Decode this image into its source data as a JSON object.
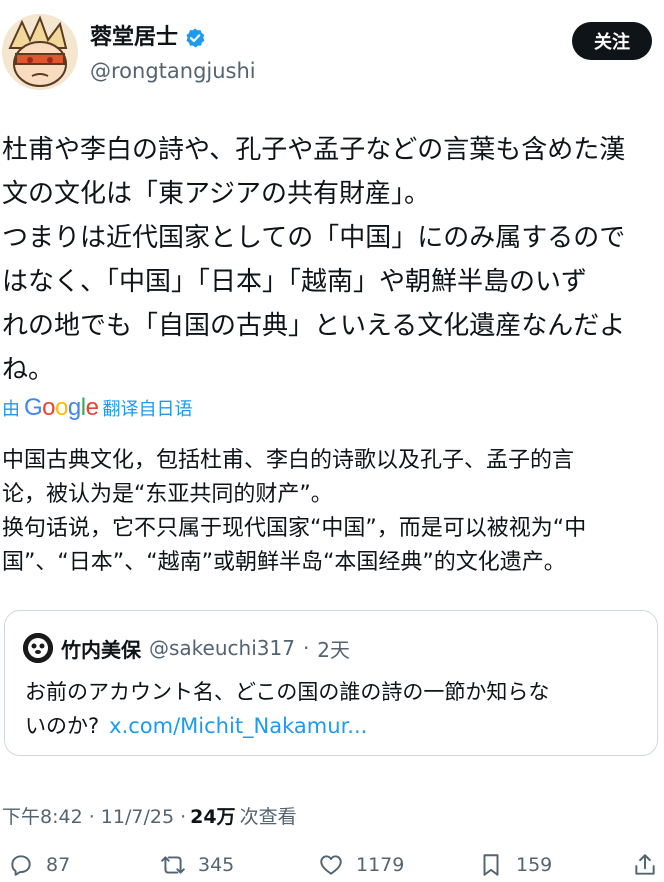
{
  "author": {
    "display_name": "蓉堂居士",
    "handle": "@rongtangjushi",
    "follow_label": "关注"
  },
  "tweet": {
    "text": "杜甫や李白の詩や、孔子や孟子などの言葉も含めた漢\n文の文化は「東アジアの共有財産」。\nつまりは近代国家としての「中国」にのみ属するので\nはなく、「中国」「日本」「越南」や朝鮮半島のいず\nれの地でも「自国の古典」といえる文化遺産なんだよ\nね。"
  },
  "translation": {
    "prefix": "由",
    "provider": "Google",
    "action": "翻译自日语",
    "text": "中国古典文化，包括杜甫、李白的诗歌以及孔子、孟子的言\n论，被认为是“东亚共同的财产”。\n换句话说，它不只属于现代国家“中国”，而是可以被视为“中\n国”、“日本”、“越南”或朝鲜半岛“本国经典”的文化遗产。"
  },
  "quote": {
    "display_name": "竹内美保",
    "handle": "@sakeuchi317",
    "separator": "·",
    "time": "2天",
    "text": "お前のアカウント名、どこの国の誰の詩の一節か知らな\nいのか?",
    "link": "x.com/Michit_Nakamur..."
  },
  "meta": {
    "time": "下午8:42 · 11/7/25 ·",
    "views_count": "24万",
    "views_label": "次查看"
  },
  "actions": {
    "replies": "87",
    "reposts": "345",
    "likes": "1179",
    "bookmarks": "159"
  },
  "colors": {
    "accent": "#1d9bf0",
    "text": "#0f1419",
    "secondary": "#536471",
    "border": "#cfd9de"
  }
}
